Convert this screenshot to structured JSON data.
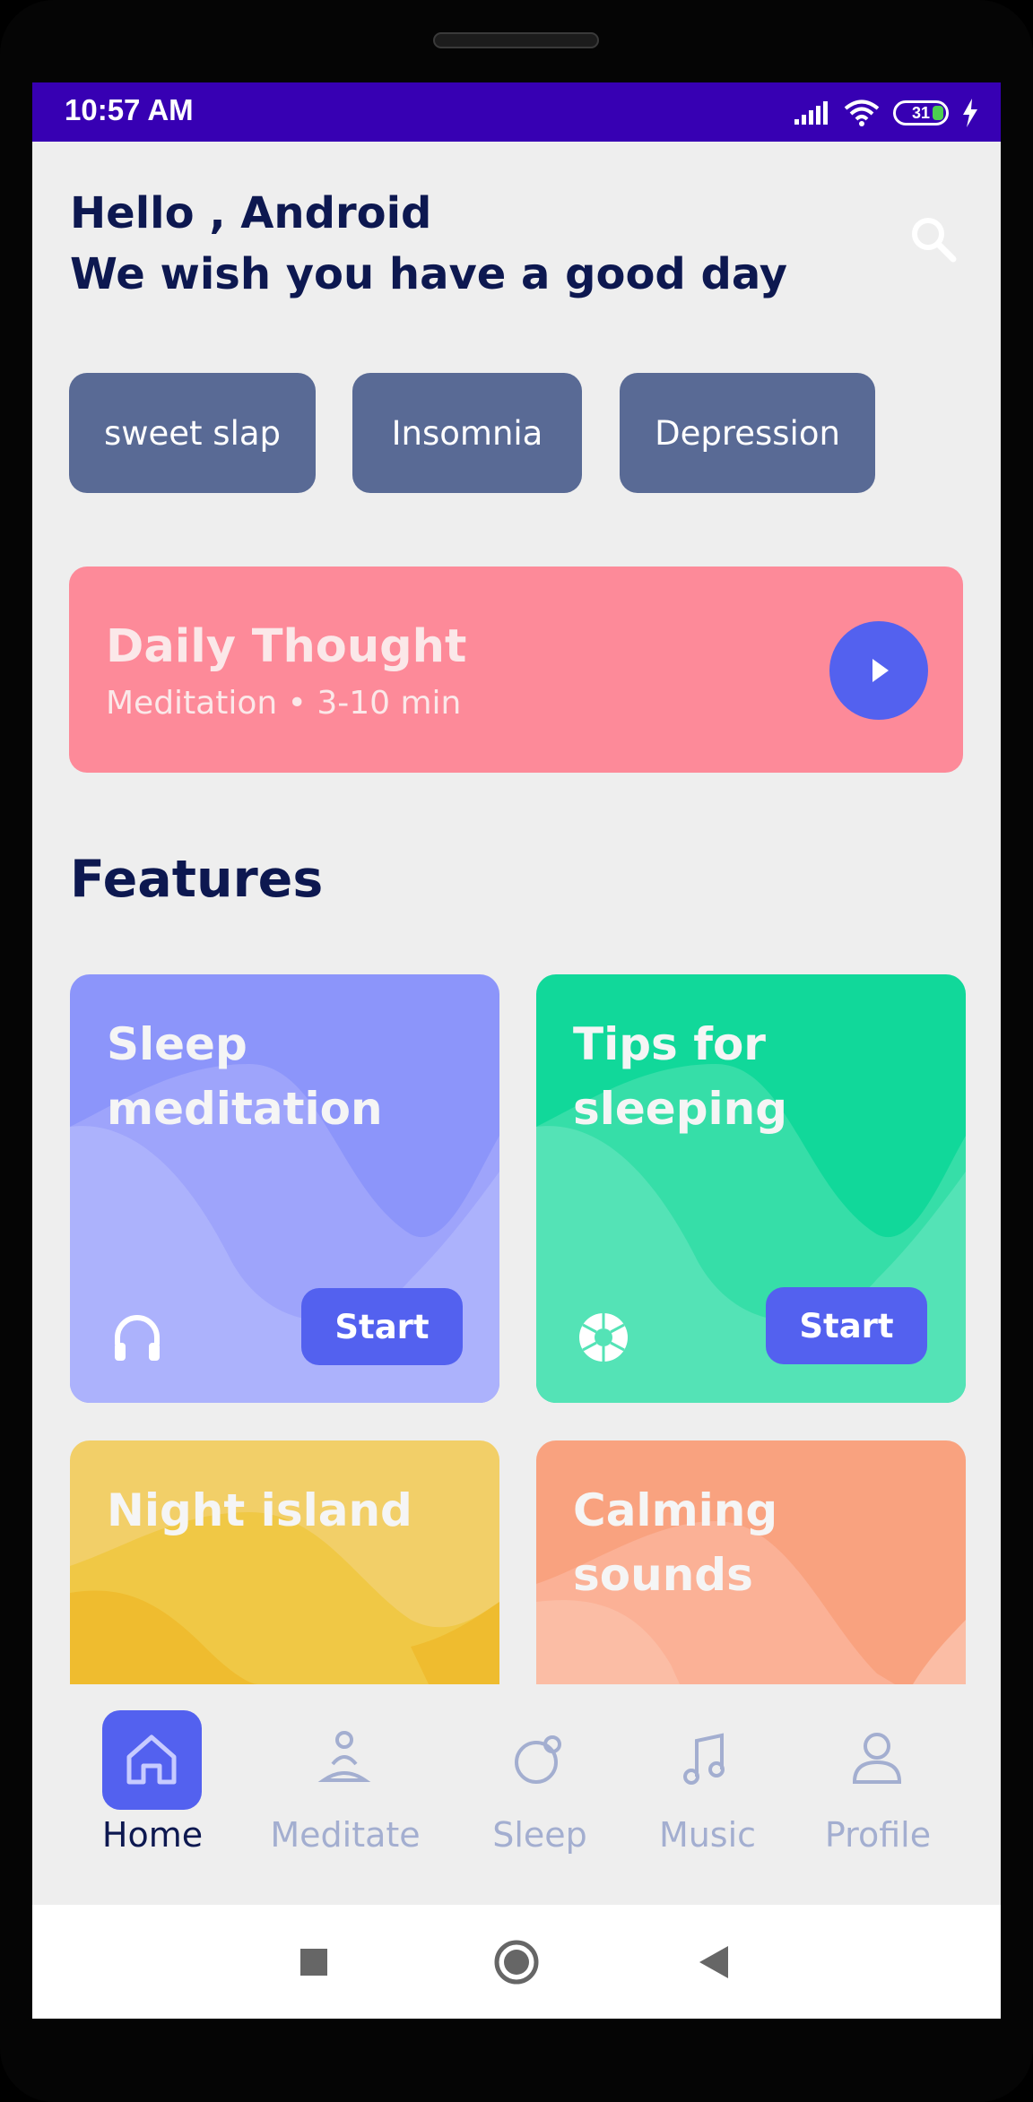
{
  "status_bar": {
    "time": "10:57 AM",
    "battery": "31"
  },
  "header": {
    "greeting_line1": "Hello , Android",
    "greeting_line2": "We wish you have a good day",
    "search_icon": "search-icon"
  },
  "chips": [
    {
      "label": "sweet slap"
    },
    {
      "label": "Insomnia"
    },
    {
      "label": "Depression"
    }
  ],
  "daily_thought": {
    "title": "Daily Thought",
    "subtitle": "Meditation • 3-10 min",
    "play_icon": "play-icon"
  },
  "features": {
    "title": "Features",
    "cards": [
      {
        "title": "Sleep meditation",
        "button": "Start",
        "icon": "headphones-icon",
        "color": "#8c95fa"
      },
      {
        "title": "Tips for sleeping",
        "button": "Start",
        "icon": "aperture-icon",
        "color": "#11d89a"
      },
      {
        "title": "Night island",
        "color": "#f2cf68"
      },
      {
        "title": "Calming sounds",
        "color": "#f9a27f"
      }
    ]
  },
  "bottom_nav": {
    "items": [
      {
        "label": "Home",
        "icon": "home-icon",
        "selected": true
      },
      {
        "label": "Meditate",
        "icon": "meditate-icon"
      },
      {
        "label": "Sleep",
        "icon": "sleep-icon"
      },
      {
        "label": "Music",
        "icon": "music-icon"
      },
      {
        "label": "Profile",
        "icon": "profile-icon"
      }
    ]
  },
  "colors": {
    "accent": "#5361ef",
    "status_bar": "#3700b3",
    "heading": "#0d1850",
    "chip": "#596a95",
    "daily_card": "#fd8a99",
    "nav_inactive": "#a3aed0"
  }
}
